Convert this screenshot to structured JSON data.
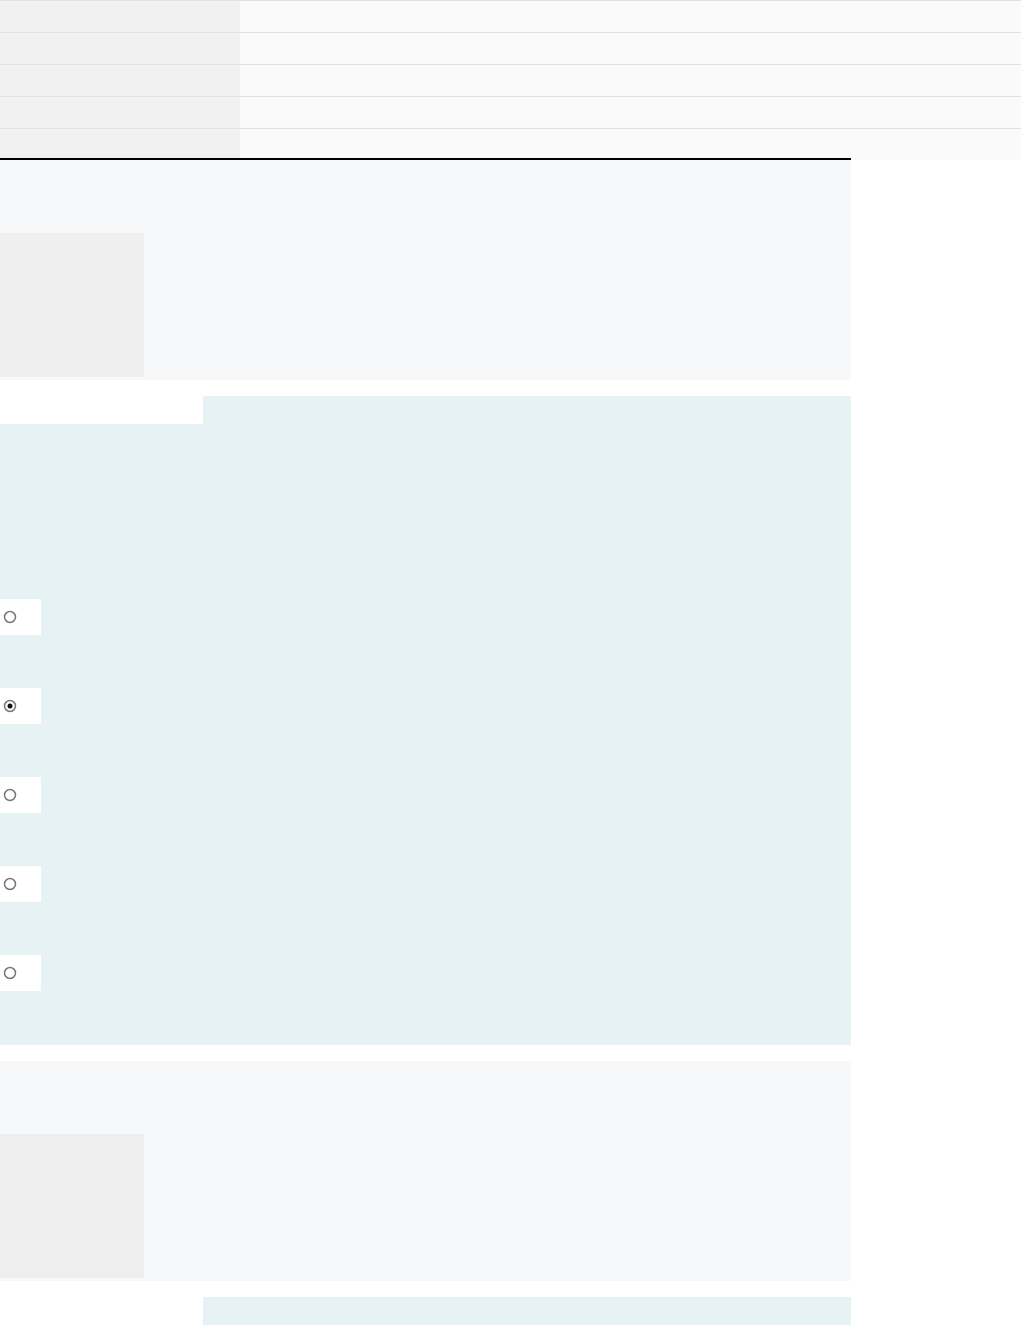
{
  "table": {
    "rows": [
      {
        "kind": "row"
      },
      {
        "kind": "row"
      },
      {
        "kind": "row"
      },
      {
        "kind": "row"
      },
      {
        "kind": "row"
      }
    ]
  },
  "sections": [
    {
      "kind": "panel"
    },
    {
      "kind": "choices",
      "options": [
        {
          "selected": false
        },
        {
          "selected": true
        },
        {
          "selected": false
        },
        {
          "selected": false
        },
        {
          "selected": false
        }
      ]
    },
    {
      "kind": "panel"
    },
    {
      "kind": "choices"
    }
  ]
}
